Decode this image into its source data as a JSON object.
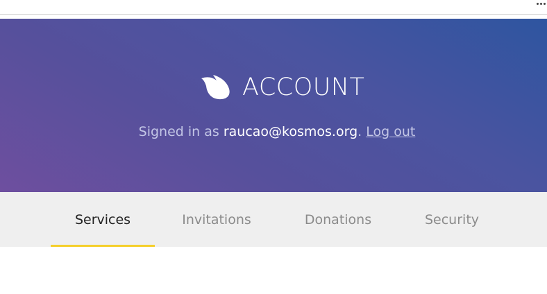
{
  "browser": {
    "more_icon": "ellipsis-icon"
  },
  "hero": {
    "title": "ACCOUNT",
    "logo_icon": "kosmos-wing-logo-icon",
    "signed_in_prefix": "Signed in as",
    "email": "raucao@kosmos.org",
    "separator": ".",
    "logout_label": "Log out",
    "colors": {
      "gradient_start": "#6e4f9f",
      "gradient_end": "#2e55a0"
    }
  },
  "tabs": {
    "items": [
      {
        "label": "Services",
        "active": true
      },
      {
        "label": "Invitations",
        "active": false
      },
      {
        "label": "Donations",
        "active": false
      },
      {
        "label": "Security",
        "active": false
      }
    ],
    "active_indicator_color": "#f5cf2b"
  }
}
